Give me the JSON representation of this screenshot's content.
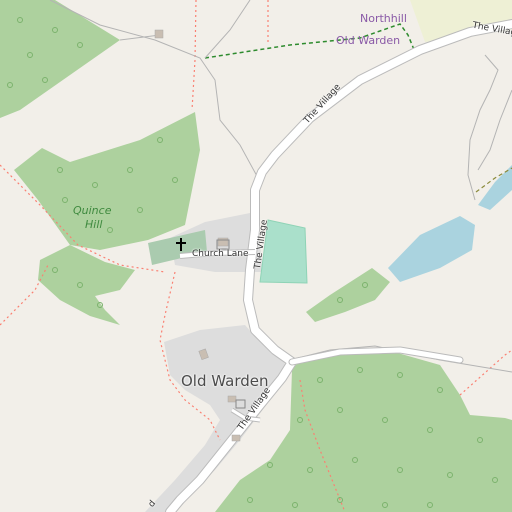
{
  "map": {
    "colors": {
      "background": "#f2efe9",
      "wood": "#add19e",
      "village": "#dddddd",
      "grass_pitch": "#aae0cb",
      "water": "#aad3df",
      "road": "#ffffff",
      "road_casing": "#bbbbbb",
      "boundary": "#8a5aa7",
      "path": "#fa8072",
      "cemetery": "#aacbaf",
      "farmland": "#eef0d5"
    },
    "labels": {
      "northhill": "Northhill",
      "old_warden_boundary": "Old Warden",
      "village_road_ne": "The Village",
      "village_road_north": "The Village",
      "village_road_center": "The Village",
      "village_road_south": "The Village",
      "church_lane": "Church Lane",
      "quince_hill_1": "Quince",
      "quince_hill_2": "Hill",
      "old_warden_place": "Old Warden",
      "road_fragment": "d"
    },
    "icons": {
      "church": "christian-church-icon",
      "place_of_worship": "church-building-icon",
      "house": "building-icon"
    }
  }
}
